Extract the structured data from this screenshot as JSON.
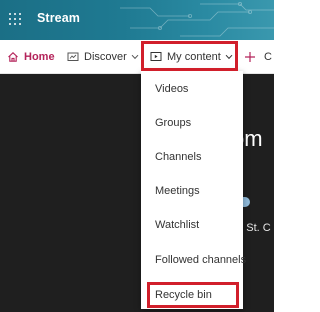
{
  "topbar": {
    "app_title": "Stream",
    "waffle_icon": "waffle-icon",
    "background": "#1f7a92"
  },
  "nav": {
    "home": {
      "label": "Home",
      "icon": "home-icon",
      "color": "#b4235a"
    },
    "discover": {
      "label": "Discover",
      "icon": "discover-icon"
    },
    "my_content": {
      "label": "My content",
      "icon": "video-icon"
    },
    "create": {
      "label": "C",
      "icon": "plus-icon"
    }
  },
  "dropdown": {
    "items": [
      {
        "label": "Videos"
      },
      {
        "label": "Groups"
      },
      {
        "label": "Channels"
      },
      {
        "label": "Meetings"
      },
      {
        "label": "Watchlist"
      },
      {
        "label": "Followed channels"
      },
      {
        "label": "Recycle bin"
      }
    ]
  },
  "background_content": {
    "hero_text": "om",
    "side_text": "to St. C"
  },
  "colors": {
    "highlight": "#d11f2b",
    "dark_background": "#1f1f1f"
  }
}
